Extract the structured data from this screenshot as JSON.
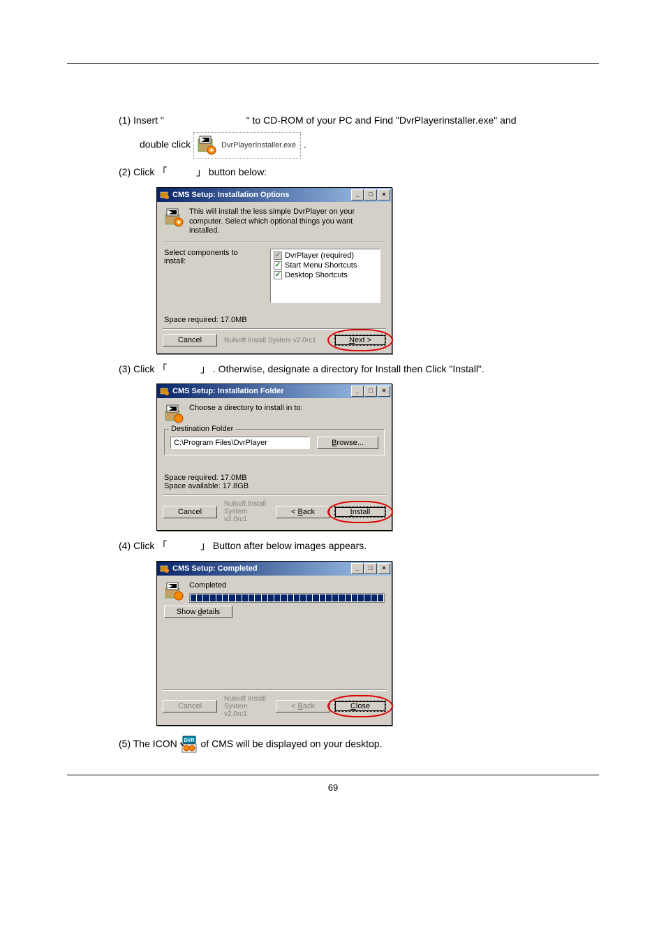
{
  "step1": {
    "prefix": "(1) Insert \"",
    "mid": "\" to CD-ROM of your PC and Find \"DvrPlayerinstaller.exe\" and",
    "line2a": "double click ",
    "file_label": "DvrPlayerInstaller.exe",
    "line2b": " ."
  },
  "step2": {
    "text_a": "(2) Click ",
    "bracket_l": "「",
    "bracket_r": "」",
    "text_b": " button below:"
  },
  "dialog1": {
    "title": "CMS Setup: Installation Options",
    "desc": "This will install the less simple DvrPlayer on your computer. Select which optional things you want installed.",
    "select_label": "Select components to install:",
    "opt1": "DvrPlayer (required)",
    "opt2": "Start Menu Shortcuts",
    "opt3": "Desktop Shortcuts",
    "space": "Space required: 17.0MB",
    "cancel": "Cancel",
    "nsis": "Nulsoft Install System v2.0rc1",
    "next": "Next >"
  },
  "step3": {
    "text_a": "(3) Click ",
    "bracket_l": "「",
    "bracket_r": "」",
    "text_b": ". Otherwise, designate a directory for Install then Click \"Install\"."
  },
  "dialog2": {
    "title": "CMS Setup: Installation Folder",
    "desc": "Choose a directory to install in to:",
    "group": "Destination Folder",
    "path": "C:\\Program Files\\DvrPlayer",
    "browse": "Browse...",
    "space_req": "Space required: 17.0MB",
    "space_avail": "Space available: 17.8GB",
    "cancel": "Cancel",
    "nsis": "Nulsoft Install System v2.0rc1",
    "back": "< Back",
    "install": "Install"
  },
  "step4": {
    "text_a": "(4) Click ",
    "bracket_l": "「",
    "bracket_r": "」",
    "text_b": " Button after below images appears."
  },
  "dialog3": {
    "title": "CMS Setup: Completed",
    "completed": "Completed",
    "show_details": "Show details",
    "cancel": "Cancel",
    "nsis": "Nulsoft Install System v2.0rc1",
    "back": "< Back",
    "close": "Close"
  },
  "step5": {
    "text_a": "(5) The ICON ",
    "dvr_label": "DVR",
    "text_b": " of CMS will be displayed on your desktop."
  },
  "page_number": "69",
  "win_btns": {
    "min": "_",
    "max": "□",
    "close": "×"
  }
}
